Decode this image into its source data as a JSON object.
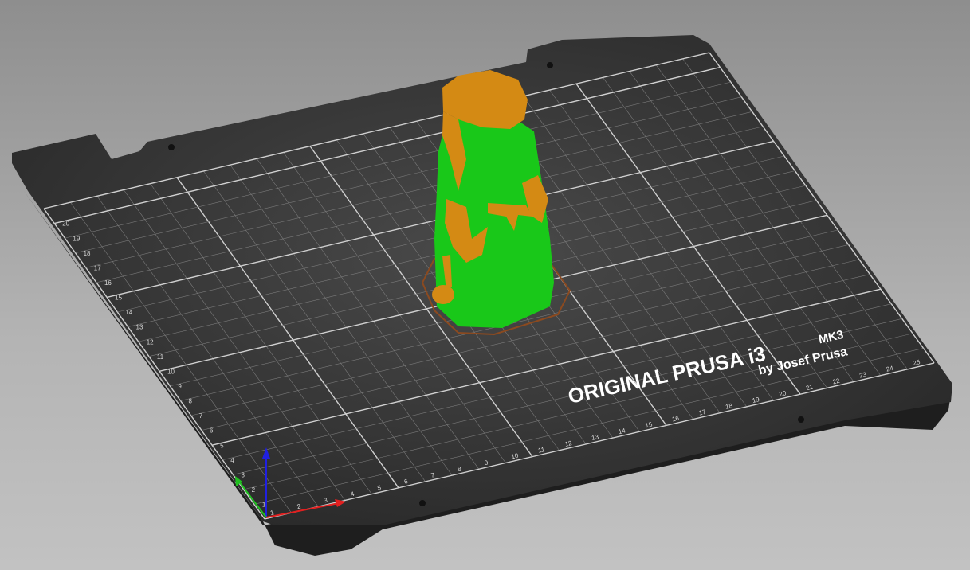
{
  "bed": {
    "logo_main": "ORIGINAL PRUSA i3",
    "logo_model": "MK3",
    "logo_sub": "by Josef Prusa",
    "x_ticks": [
      "1",
      "2",
      "3",
      "4",
      "5",
      "6",
      "7",
      "8",
      "9",
      "10",
      "11",
      "12",
      "13",
      "14",
      "15",
      "16",
      "17",
      "18",
      "19",
      "20",
      "21",
      "22",
      "23",
      "24",
      "25"
    ],
    "y_ticks": [
      "1",
      "2",
      "3",
      "4",
      "5",
      "6",
      "7",
      "8",
      "9",
      "10",
      "11",
      "12",
      "13",
      "14",
      "15",
      "16",
      "17",
      "18",
      "19",
      "20"
    ]
  },
  "colors": {
    "bed": "#303030",
    "grid": "#7a7a7a",
    "grid_major": "#d0d0d0",
    "support": "#19c819",
    "model": "#d48a14",
    "skirt": "#8b4a20",
    "axis_x": "#e02020",
    "axis_y": "#20c020",
    "axis_z": "#2020e0"
  }
}
